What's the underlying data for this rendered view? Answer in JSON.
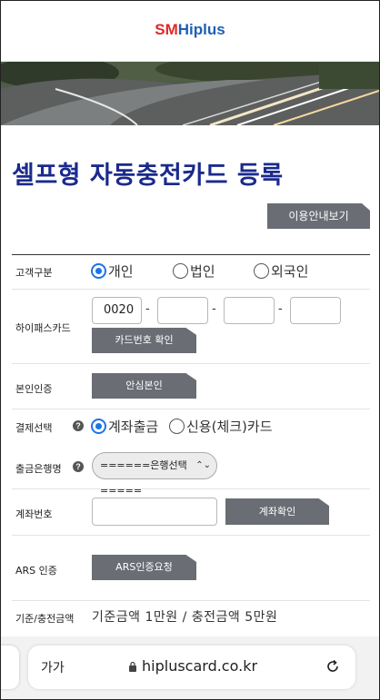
{
  "header": {
    "logo_sm": "SM",
    "logo_hiplus": "Hiplus"
  },
  "title": "셀프형 자동충전카드 등록",
  "guide_button": "이용안내보기",
  "customer_type": {
    "label": "고객구분",
    "options": [
      "개인",
      "법인",
      "외국인"
    ],
    "selected": "개인"
  },
  "hipass_card": {
    "label": "하이패스카드",
    "fields": [
      "0020",
      "",
      "",
      ""
    ],
    "separator": "-",
    "confirm_button": "카드번호 확인"
  },
  "identity": {
    "label": "본인인증",
    "button": "안심본인"
  },
  "payment": {
    "label": "결제선택",
    "options": [
      "계좌출금",
      "신용(체크)카드"
    ],
    "selected": "계좌출금"
  },
  "bank": {
    "label": "출금은행명",
    "select_value": "======은행선택====="
  },
  "account": {
    "label": "계좌번호",
    "value": "",
    "button": "계좌확인"
  },
  "ars": {
    "label": "ARS 인증",
    "button": "ARS인증요청"
  },
  "charge": {
    "label": "기준/충전금액",
    "value": "기준금액 1만원 / 충전금액 5만원"
  },
  "browser": {
    "text_size": "가가",
    "url": "hipluscard.co.kr"
  },
  "colors": {
    "accent": "#1e73e8",
    "title": "#1a2a8c",
    "button": "#6a6d74"
  }
}
